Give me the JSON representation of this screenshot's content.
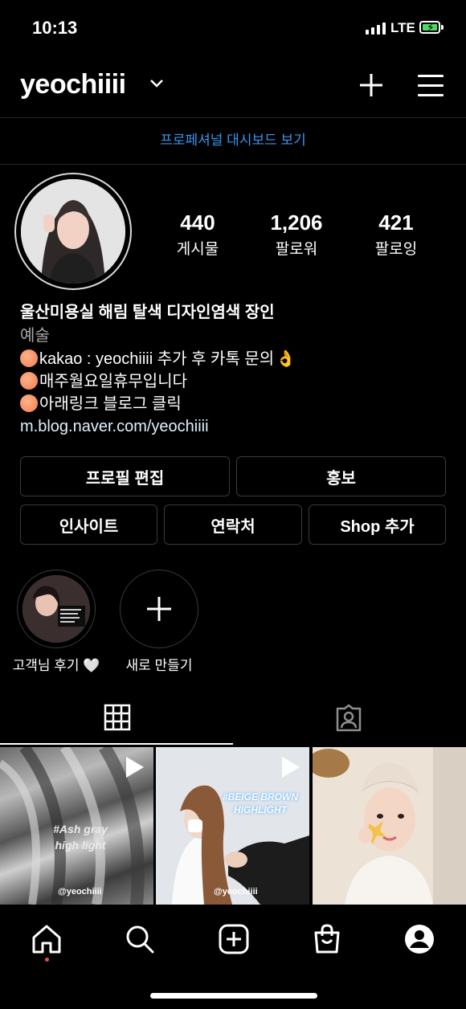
{
  "status_bar": {
    "time": "10:13",
    "network": "LTE"
  },
  "header": {
    "username": "yeochiiii"
  },
  "dashboard_link": "프로페셔널 대시보드 보기",
  "stats": [
    {
      "value": "440",
      "label": "게시물"
    },
    {
      "value": "1,206",
      "label": "팔로워"
    },
    {
      "value": "421",
      "label": "팔로잉"
    }
  ],
  "bio": {
    "name": "울산미용실 해림 탈색 디자인염색 장인",
    "category": "예술",
    "line1": "kakao : yeochiiii 추가 후 카톡 문의",
    "line2": "매주월요일휴무입니다",
    "line3": "아래링크 블로그 클릭",
    "link": "m.blog.naver.com/yeochiiii"
  },
  "buttons": {
    "edit_profile": "프로필 편집",
    "promote": "홍보",
    "insights": "인사이트",
    "contact": "연락처",
    "add_shop": "Shop 추가"
  },
  "highlights": [
    {
      "label": "고객님 후기 🤍"
    },
    {
      "label": "새로 만들기"
    }
  ],
  "grid": [
    {
      "caption": "#Ash gray\nhigh light",
      "watermark": "@yeochiiii"
    },
    {
      "caption": "#BEIGE BROWN\nHIGHLIGHT",
      "watermark": "@yeochiiii"
    },
    {
      "caption": "",
      "watermark": ""
    }
  ],
  "icons": {
    "header": [
      "chevron-down-icon",
      "plus-icon",
      "menu-icon"
    ],
    "tabs": [
      "grid-icon",
      "tagged-icon"
    ],
    "nav": [
      "home-icon",
      "search-icon",
      "new-post-icon",
      "shop-icon",
      "profile-icon"
    ]
  }
}
